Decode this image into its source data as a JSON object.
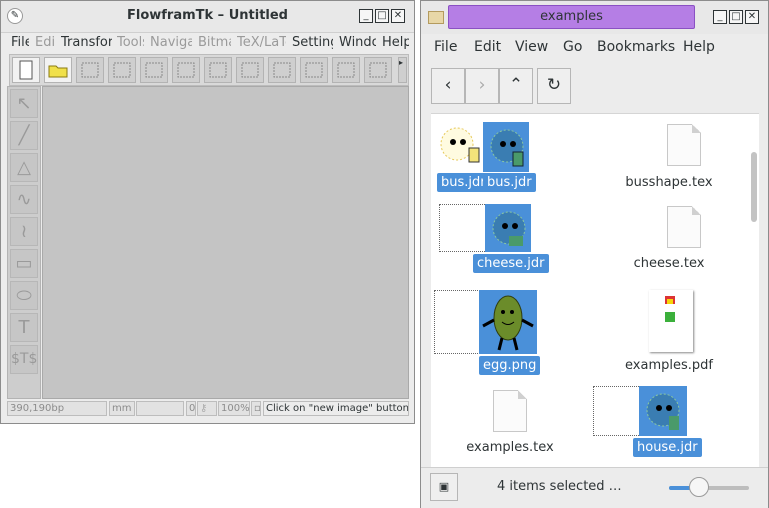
{
  "flowframtk": {
    "title": "FlowframTk – Untitled",
    "menu": [
      {
        "label": "File",
        "enabled": true
      },
      {
        "label": "Edit",
        "enabled": false
      },
      {
        "label": "Transform",
        "enabled": true
      },
      {
        "label": "Tools",
        "enabled": false
      },
      {
        "label": "Navigate",
        "enabled": false
      },
      {
        "label": "Bitmap",
        "enabled": false
      },
      {
        "label": "TeX/LaTeX",
        "enabled": false
      },
      {
        "label": "Settings",
        "enabled": true
      },
      {
        "label": "Window",
        "enabled": true
      },
      {
        "label": "Help",
        "enabled": true
      }
    ],
    "toolbar_icons": [
      "new-file-icon",
      "open-folder-icon",
      "save-icon",
      "image-select-icon",
      "image-description-icon",
      "image-move-icon",
      "bitmap-icon",
      "path-edit-icon",
      "distribute-icon",
      "grid-icon",
      "shape-icon",
      "resize-icon",
      "toolbar-more-icon"
    ],
    "sidebar_tools": [
      {
        "name": "select-tool",
        "glyph": "↖"
      },
      {
        "name": "open-line-tool",
        "glyph": "╱"
      },
      {
        "name": "closed-line-tool",
        "glyph": "△"
      },
      {
        "name": "open-curve-tool",
        "glyph": "∿"
      },
      {
        "name": "closed-curve-tool",
        "glyph": "≀"
      },
      {
        "name": "rectangle-tool",
        "glyph": "▭"
      },
      {
        "name": "ellipse-tool",
        "glyph": "⬭"
      },
      {
        "name": "text-tool",
        "glyph": "T"
      },
      {
        "name": "math-tool",
        "glyph": "$T$"
      }
    ],
    "status": {
      "coords": "390,190bp",
      "unit": "mm",
      "blank": "",
      "zoom_prefix": "0",
      "zoom": "100%",
      "message": "Click on \"new image\" button"
    }
  },
  "files": {
    "title": "examples",
    "menu": [
      "File",
      "Edit",
      "View",
      "Go",
      "Bookmarks",
      "Help"
    ],
    "nav": {
      "back": "‹",
      "forward": "›",
      "up": "⌃",
      "reload": "↻"
    },
    "items": [
      {
        "name": "bus.jdr",
        "selected": true
      },
      {
        "name": "bus.jdr",
        "selected": true
      },
      {
        "name": "busshape.tex",
        "selected": false
      },
      {
        "name": "cheese.jdr",
        "selected": true
      },
      {
        "name": "cheese.tex",
        "selected": false
      },
      {
        "name": "egg.png",
        "selected": true
      },
      {
        "name": "examples.pdf",
        "selected": false
      },
      {
        "name": "examples.tex",
        "selected": false
      },
      {
        "name": "house.jdr",
        "selected": true
      }
    ],
    "status": "4 items selected …",
    "zoom_level": 0.38
  },
  "colors": {
    "selection": "#4a90d9",
    "title_pill": "#b57ee5",
    "canvas": "#c4c4c4"
  }
}
